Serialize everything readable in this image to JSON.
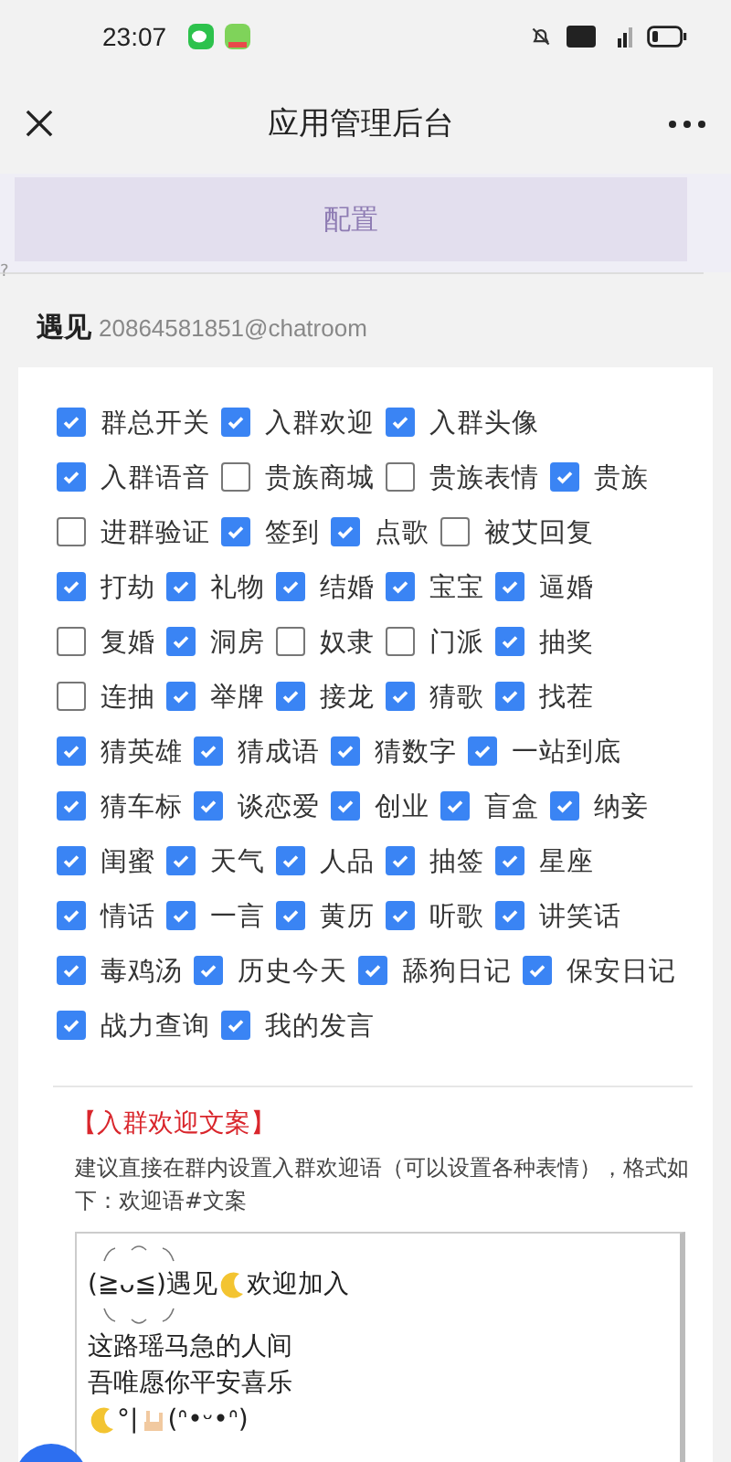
{
  "status_bar": {
    "time": "23:07"
  },
  "header": {
    "title": "应用管理后台"
  },
  "config_button": {
    "label": "配置"
  },
  "help_mark": "?",
  "group": {
    "name": "遇见",
    "id": "20864581851@chatroom"
  },
  "switch_rows": [
    [
      {
        "label": "群总开关",
        "checked": true
      },
      {
        "label": "入群欢迎",
        "checked": true
      },
      {
        "label": "入群头像",
        "checked": true
      }
    ],
    [
      {
        "label": "入群语音",
        "checked": true
      },
      {
        "label": "贵族商城",
        "checked": false
      },
      {
        "label": "贵族表情",
        "checked": false
      },
      {
        "label": "贵族",
        "checked": true
      }
    ],
    [
      {
        "label": "进群验证",
        "checked": false
      },
      {
        "label": "签到",
        "checked": true
      },
      {
        "label": "点歌",
        "checked": true
      },
      {
        "label": "被艾回复",
        "checked": false
      }
    ],
    [
      {
        "label": "打劫",
        "checked": true
      },
      {
        "label": "礼物",
        "checked": true
      },
      {
        "label": "结婚",
        "checked": true
      },
      {
        "label": "宝宝",
        "checked": true
      },
      {
        "label": "逼婚",
        "checked": true
      }
    ],
    [
      {
        "label": "复婚",
        "checked": false
      },
      {
        "label": "洞房",
        "checked": true
      },
      {
        "label": "奴隶",
        "checked": false
      },
      {
        "label": "门派",
        "checked": false
      },
      {
        "label": "抽奖",
        "checked": true
      }
    ],
    [
      {
        "label": "连抽",
        "checked": false
      },
      {
        "label": "举牌",
        "checked": true
      },
      {
        "label": "接龙",
        "checked": true
      },
      {
        "label": "猜歌",
        "checked": true
      },
      {
        "label": "找茬",
        "checked": true
      }
    ],
    [
      {
        "label": "猜英雄",
        "checked": true
      },
      {
        "label": "猜成语",
        "checked": true
      },
      {
        "label": "猜数字",
        "checked": true
      },
      {
        "label": "一站到底",
        "checked": true
      }
    ],
    [
      {
        "label": "猜车标",
        "checked": true
      },
      {
        "label": "谈恋爱",
        "checked": true
      },
      {
        "label": "创业",
        "checked": true
      },
      {
        "label": "盲盒",
        "checked": true
      },
      {
        "label": "纳妾",
        "checked": true
      }
    ],
    [
      {
        "label": "闺蜜",
        "checked": true
      },
      {
        "label": "天气",
        "checked": true
      },
      {
        "label": "人品",
        "checked": true
      },
      {
        "label": "抽签",
        "checked": true
      },
      {
        "label": "星座",
        "checked": true
      }
    ],
    [
      {
        "label": "情话",
        "checked": true
      },
      {
        "label": "一言",
        "checked": true
      },
      {
        "label": "黄历",
        "checked": true
      },
      {
        "label": "听歌",
        "checked": true
      },
      {
        "label": "讲笑话",
        "checked": true
      }
    ],
    [
      {
        "label": "毒鸡汤",
        "checked": true
      },
      {
        "label": "历史今天",
        "checked": true
      },
      {
        "label": "舔狗日记",
        "checked": true
      },
      {
        "label": "保安日记",
        "checked": true
      }
    ],
    [
      {
        "label": "战力查询",
        "checked": true
      },
      {
        "label": "我的发言",
        "checked": true
      }
    ]
  ],
  "welcome": {
    "title": "【入群欢迎文案】",
    "hint": "建议直接在群内设置入群欢迎语（可以设置各种表情），格式如下：欢迎语#文案",
    "lines": [
      {
        "kind": "greeting",
        "before": "(≧ᴗ≦)遇见",
        "after": "欢迎加入"
      },
      {
        "kind": "plain",
        "text": "这路瑶马急的人间"
      },
      {
        "kind": "plain",
        "text": "吾唯愿你平安喜乐"
      },
      {
        "kind": "emoji",
        "before": "°|",
        "after": "(ᐢ•ᵕ•ᐢ)"
      }
    ]
  }
}
